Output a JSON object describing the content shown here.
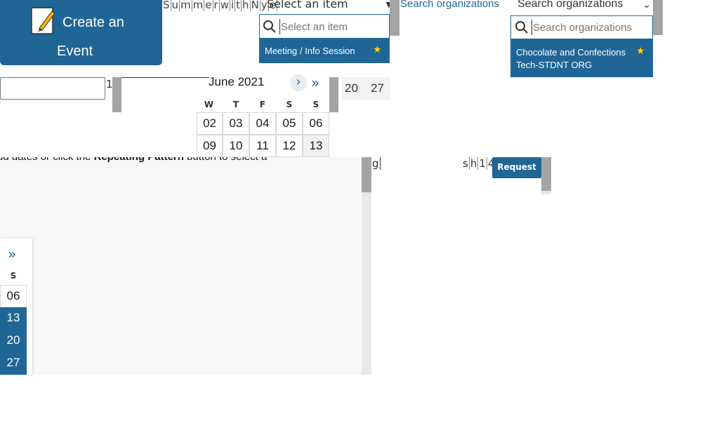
{
  "create_event": {
    "line1": "Create an",
    "line2": "Event",
    "icon": "pencil-paper-icon"
  },
  "title_chars": [
    "S",
    "u",
    "m",
    "m",
    "e",
    "r",
    "w",
    "i",
    "t",
    "h",
    "N",
    "y",
    "e"
  ],
  "item_select": {
    "value": "Select an item",
    "search_placeholder": "Select an item",
    "option_label": "Meeting / Info Session",
    "option_starred": true
  },
  "org_select": {
    "link_label": "Search organizations",
    "value": "Search organizations",
    "search_placeholder": "Search organizations",
    "option_name": "Chocolate and Confections",
    "option_sub": "Tech-STDNT ORG",
    "option_starred": true
  },
  "date_input": {
    "value": "",
    "tail": "1"
  },
  "calendar": {
    "month": "June 2021",
    "next_icon": "chevron-right-icon",
    "fast_icon": "double-chevron-right-icon",
    "headers": [
      "W",
      "T",
      "F",
      "S",
      "S"
    ],
    "row1": [
      "02",
      "03",
      "04",
      "05",
      "06"
    ],
    "row2": [
      "09",
      "10",
      "11",
      "12",
      "13"
    ],
    "next_col": [
      "20",
      "27"
    ]
  },
  "panel": {
    "text_before": "dd dates or click the ",
    "text_bold": "Repeating Pattern",
    "text_after": " button to select a"
  },
  "mini_calendar": {
    "header": "S",
    "days": [
      "06",
      "13",
      "20",
      "27"
    ]
  },
  "right": {
    "g_text": "g",
    "sh_chars": [
      "s",
      "h",
      "1",
      "4"
    ],
    "request_label": "Request"
  }
}
